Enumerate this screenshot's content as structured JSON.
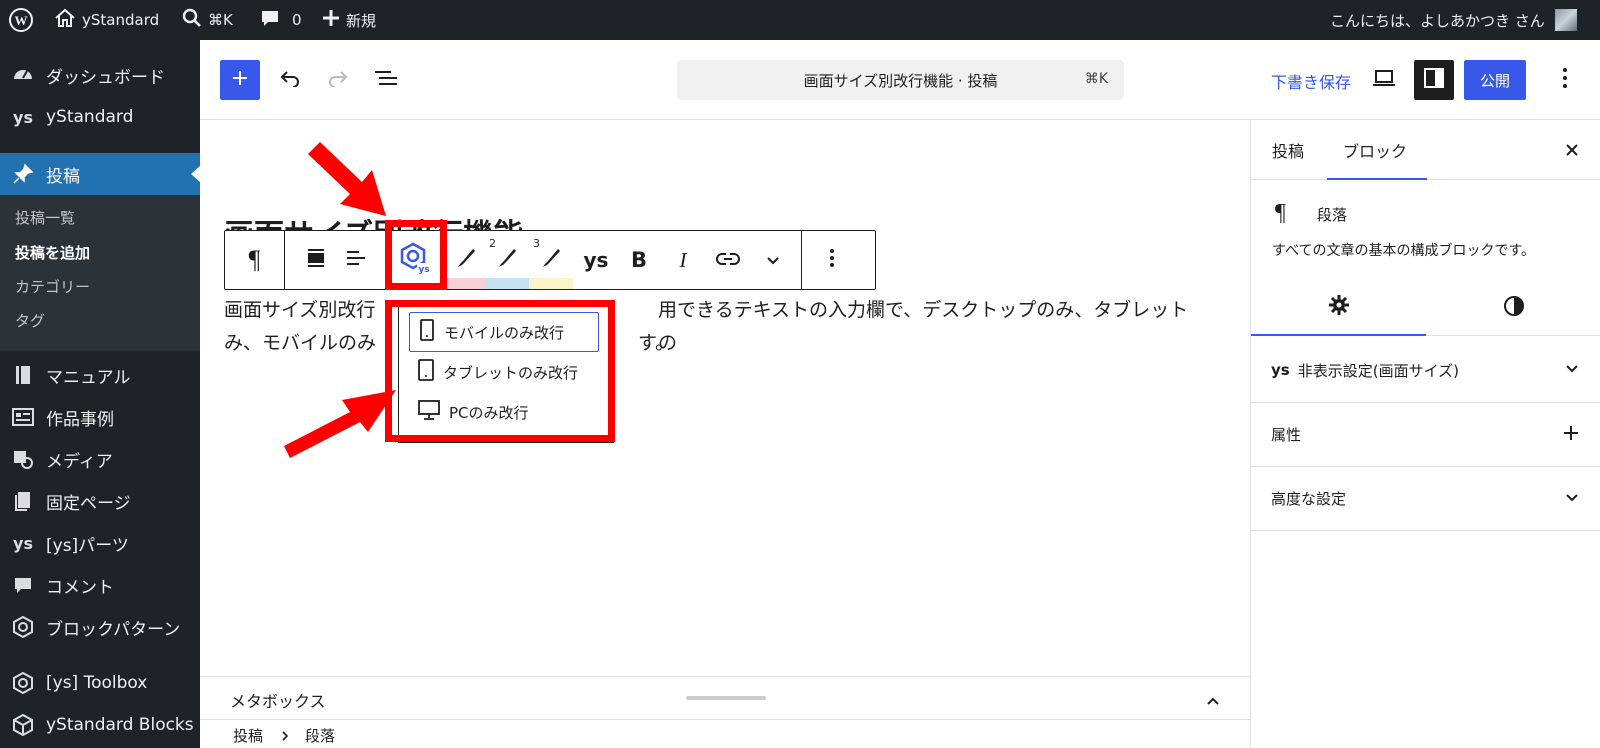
{
  "admin_bar": {
    "site_name": "yStandard",
    "search_shortcut": "⌘K",
    "comments_count": "0",
    "new_label": "新規",
    "greeting": "こんにちは、よしあかつき さん"
  },
  "sidebar": {
    "items": [
      {
        "label": "ダッシュボード",
        "icon": "dashboard-icon"
      },
      {
        "label": "yStandard",
        "icon": "ys-icon"
      },
      {
        "label": "投稿",
        "icon": "pin-icon"
      },
      {
        "label": "マニュアル",
        "icon": "book-icon"
      },
      {
        "label": "作品事例",
        "icon": "list-icon"
      },
      {
        "label": "メディア",
        "icon": "media-icon"
      },
      {
        "label": "固定ページ",
        "icon": "pages-icon"
      },
      {
        "label": "[ys]パーツ",
        "icon": "ys-icon"
      },
      {
        "label": "コメント",
        "icon": "comment-icon"
      },
      {
        "label": "ブロックパターン",
        "icon": "hexagon-icon"
      },
      {
        "label": "[ys] Toolbox",
        "icon": "hexagon-icon"
      },
      {
        "label": "yStandard Blocks",
        "icon": "cube-icon"
      }
    ],
    "submenu": [
      "投稿一覧",
      "投稿を追加",
      "カテゴリー",
      "タグ"
    ]
  },
  "header": {
    "doc_title": "画面サイズ別改行機能 · 投稿",
    "doc_shortcut": "⌘K",
    "save_draft": "下書き保存",
    "publish": "公開"
  },
  "content": {
    "title_partial": "画面サイズ別改行機能",
    "paragraph_line1": "画面サイズ別改行機能は、ブロックエディターで利用できるテキストの入力欄で、デスクトップのみ、タブレットのみ、モバイルのみで改行できるようにする機能です。",
    "para_l1_a": "画面サイズ別改行",
    "para_l1_b": "用できるテキストの入力欄で、デスクトップのみ、タブレットの",
    "para_l2_a": "み、モバイルのみ",
    "para_l2_b": "す。"
  },
  "toolbar": {
    "sup2": "2",
    "sup3": "3",
    "ys_label": "ys",
    "bold": "B",
    "italic": "I"
  },
  "dropdown": {
    "items": [
      "モバイルのみ改行",
      "タブレットのみ改行",
      "PCのみ改行"
    ]
  },
  "settings": {
    "tab_post": "投稿",
    "tab_block": "ブロック",
    "block_name": "段落",
    "block_desc": "すべての文章の基本の構成ブロックです。",
    "ys_label": "ys",
    "hide_settings": "非表示設定(画面サイズ)",
    "attributes": "属性",
    "advanced": "高度な設定"
  },
  "footer": {
    "metabox": "メタボックス",
    "breadcrumb": [
      "投稿",
      "段落"
    ]
  },
  "colors": {
    "admin_bg": "#1d2327",
    "accent": "#3858e9",
    "wp_blue": "#2271b1",
    "annotation_red": "#ff0000"
  }
}
